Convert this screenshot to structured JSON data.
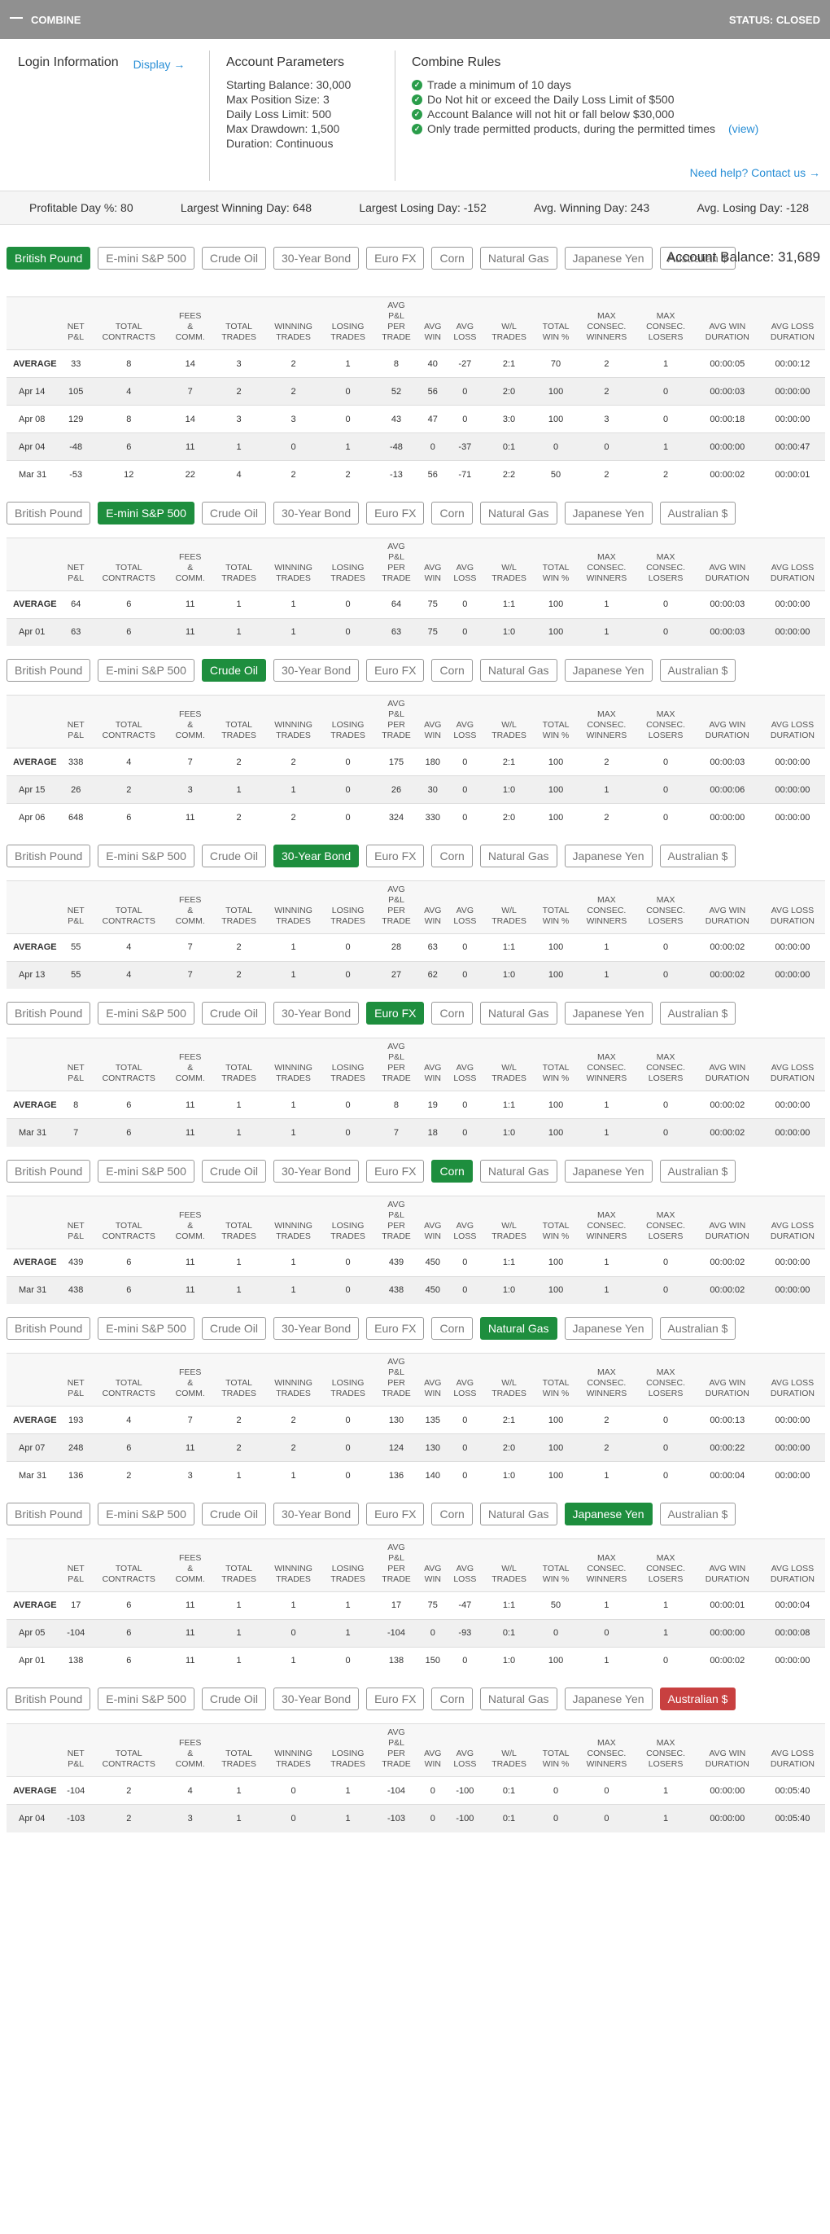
{
  "header": {
    "title": "COMBINE",
    "status": "STATUS: CLOSED"
  },
  "login": {
    "title": "Login Information",
    "display": "Display →"
  },
  "params": {
    "title": "Account Parameters",
    "items": [
      "Starting Balance: 30,000",
      "Max Position Size: 3",
      "Daily Loss Limit: 500",
      "Max Drawdown: 1,500",
      "Duration: Continuous"
    ]
  },
  "rules": {
    "title": "Combine Rules",
    "items": [
      "Trade a minimum of 10 days",
      "Do Not hit or exceed the Daily Loss Limit of $500",
      "Account Balance will not hit or fall below $30,000",
      "Only trade permitted products, during the permitted times"
    ],
    "view": "(view)"
  },
  "help": "Need help? Contact us →",
  "summary": [
    "Profitable Day %: 80",
    "Largest Winning Day: 648",
    "Largest Losing Day: -152",
    "Avg. Winning Day: 243",
    "Avg. Losing Day: -128"
  ],
  "account_balance": "Account Balance: 31,689",
  "products": [
    "British Pound",
    "E-mini S&P 500",
    "Crude Oil",
    "30-Year Bond",
    "Euro FX",
    "Corn",
    "Natural Gas",
    "Japanese Yen",
    "Australian $"
  ],
  "columns": [
    [
      "NET",
      "P&L"
    ],
    [
      "TOTAL",
      "CONTRACTS"
    ],
    [
      "FEES",
      "&",
      "COMM."
    ],
    [
      "TOTAL",
      "TRADES"
    ],
    [
      "WINNING",
      "TRADES"
    ],
    [
      "LOSING",
      "TRADES"
    ],
    [
      "AVG",
      "P&L",
      "PER",
      "TRADE"
    ],
    [
      "AVG",
      "WIN"
    ],
    [
      "AVG",
      "LOSS"
    ],
    [
      "W/L",
      "TRADES"
    ],
    [
      "TOTAL",
      "WIN %"
    ],
    [
      "MAX",
      "CONSEC.",
      "WINNERS"
    ],
    [
      "MAX",
      "CONSEC.",
      "LOSERS"
    ],
    [
      "AVG WIN",
      "DURATION"
    ],
    [
      "AVG LOSS",
      "DURATION"
    ]
  ],
  "sections": [
    {
      "active": 0,
      "rows": [
        [
          "AVERAGE",
          "33",
          "8",
          "14",
          "3",
          "2",
          "1",
          "8",
          "40",
          "-27",
          "2:1",
          "70",
          "2",
          "1",
          "00:00:05",
          "00:00:12"
        ],
        [
          "Apr 14",
          "105",
          "4",
          "7",
          "2",
          "2",
          "0",
          "52",
          "56",
          "0",
          "2:0",
          "100",
          "2",
          "0",
          "00:00:03",
          "00:00:00"
        ],
        [
          "Apr 08",
          "129",
          "8",
          "14",
          "3",
          "3",
          "0",
          "43",
          "47",
          "0",
          "3:0",
          "100",
          "3",
          "0",
          "00:00:18",
          "00:00:00"
        ],
        [
          "Apr 04",
          "-48",
          "6",
          "11",
          "1",
          "0",
          "1",
          "-48",
          "0",
          "-37",
          "0:1",
          "0",
          "0",
          "1",
          "00:00:00",
          "00:00:47"
        ],
        [
          "Mar 31",
          "-53",
          "12",
          "22",
          "4",
          "2",
          "2",
          "-13",
          "56",
          "-71",
          "2:2",
          "50",
          "2",
          "2",
          "00:00:02",
          "00:00:01"
        ]
      ]
    },
    {
      "active": 1,
      "rows": [
        [
          "AVERAGE",
          "64",
          "6",
          "11",
          "1",
          "1",
          "0",
          "64",
          "75",
          "0",
          "1:1",
          "100",
          "1",
          "0",
          "00:00:03",
          "00:00:00"
        ],
        [
          "Apr 01",
          "63",
          "6",
          "11",
          "1",
          "1",
          "0",
          "63",
          "75",
          "0",
          "1:0",
          "100",
          "1",
          "0",
          "00:00:03",
          "00:00:00"
        ]
      ]
    },
    {
      "active": 2,
      "rows": [
        [
          "AVERAGE",
          "338",
          "4",
          "7",
          "2",
          "2",
          "0",
          "175",
          "180",
          "0",
          "2:1",
          "100",
          "2",
          "0",
          "00:00:03",
          "00:00:00"
        ],
        [
          "Apr 15",
          "26",
          "2",
          "3",
          "1",
          "1",
          "0",
          "26",
          "30",
          "0",
          "1:0",
          "100",
          "1",
          "0",
          "00:00:06",
          "00:00:00"
        ],
        [
          "Apr 06",
          "648",
          "6",
          "11",
          "2",
          "2",
          "0",
          "324",
          "330",
          "0",
          "2:0",
          "100",
          "2",
          "0",
          "00:00:00",
          "00:00:00"
        ]
      ]
    },
    {
      "active": 3,
      "rows": [
        [
          "AVERAGE",
          "55",
          "4",
          "7",
          "2",
          "1",
          "0",
          "28",
          "63",
          "0",
          "1:1",
          "100",
          "1",
          "0",
          "00:00:02",
          "00:00:00"
        ],
        [
          "Apr 13",
          "55",
          "4",
          "7",
          "2",
          "1",
          "0",
          "27",
          "62",
          "0",
          "1:0",
          "100",
          "1",
          "0",
          "00:00:02",
          "00:00:00"
        ]
      ]
    },
    {
      "active": 4,
      "rows": [
        [
          "AVERAGE",
          "8",
          "6",
          "11",
          "1",
          "1",
          "0",
          "8",
          "19",
          "0",
          "1:1",
          "100",
          "1",
          "0",
          "00:00:02",
          "00:00:00"
        ],
        [
          "Mar 31",
          "7",
          "6",
          "11",
          "1",
          "1",
          "0",
          "7",
          "18",
          "0",
          "1:0",
          "100",
          "1",
          "0",
          "00:00:02",
          "00:00:00"
        ]
      ]
    },
    {
      "active": 5,
      "rows": [
        [
          "AVERAGE",
          "439",
          "6",
          "11",
          "1",
          "1",
          "0",
          "439",
          "450",
          "0",
          "1:1",
          "100",
          "1",
          "0",
          "00:00:02",
          "00:00:00"
        ],
        [
          "Mar 31",
          "438",
          "6",
          "11",
          "1",
          "1",
          "0",
          "438",
          "450",
          "0",
          "1:0",
          "100",
          "1",
          "0",
          "00:00:02",
          "00:00:00"
        ]
      ]
    },
    {
      "active": 6,
      "rows": [
        [
          "AVERAGE",
          "193",
          "4",
          "7",
          "2",
          "2",
          "0",
          "130",
          "135",
          "0",
          "2:1",
          "100",
          "2",
          "0",
          "00:00:13",
          "00:00:00"
        ],
        [
          "Apr 07",
          "248",
          "6",
          "11",
          "2",
          "2",
          "0",
          "124",
          "130",
          "0",
          "2:0",
          "100",
          "2",
          "0",
          "00:00:22",
          "00:00:00"
        ],
        [
          "Mar 31",
          "136",
          "2",
          "3",
          "1",
          "1",
          "0",
          "136",
          "140",
          "0",
          "1:0",
          "100",
          "1",
          "0",
          "00:00:04",
          "00:00:00"
        ]
      ]
    },
    {
      "active": 7,
      "rows": [
        [
          "AVERAGE",
          "17",
          "6",
          "11",
          "1",
          "1",
          "1",
          "17",
          "75",
          "-47",
          "1:1",
          "50",
          "1",
          "1",
          "00:00:01",
          "00:00:04"
        ],
        [
          "Apr 05",
          "-104",
          "6",
          "11",
          "1",
          "0",
          "1",
          "-104",
          "0",
          "-93",
          "0:1",
          "0",
          "0",
          "1",
          "00:00:00",
          "00:00:08"
        ],
        [
          "Apr 01",
          "138",
          "6",
          "11",
          "1",
          "1",
          "0",
          "138",
          "150",
          "0",
          "1:0",
          "100",
          "1",
          "0",
          "00:00:02",
          "00:00:00"
        ]
      ]
    },
    {
      "active": 8,
      "rows": [
        [
          "AVERAGE",
          "-104",
          "2",
          "4",
          "1",
          "0",
          "1",
          "-104",
          "0",
          "-100",
          "0:1",
          "0",
          "0",
          "1",
          "00:00:00",
          "00:05:40"
        ],
        [
          "Apr 04",
          "-103",
          "2",
          "3",
          "1",
          "0",
          "1",
          "-103",
          "0",
          "-100",
          "0:1",
          "0",
          "0",
          "1",
          "00:00:00",
          "00:05:40"
        ]
      ]
    }
  ]
}
